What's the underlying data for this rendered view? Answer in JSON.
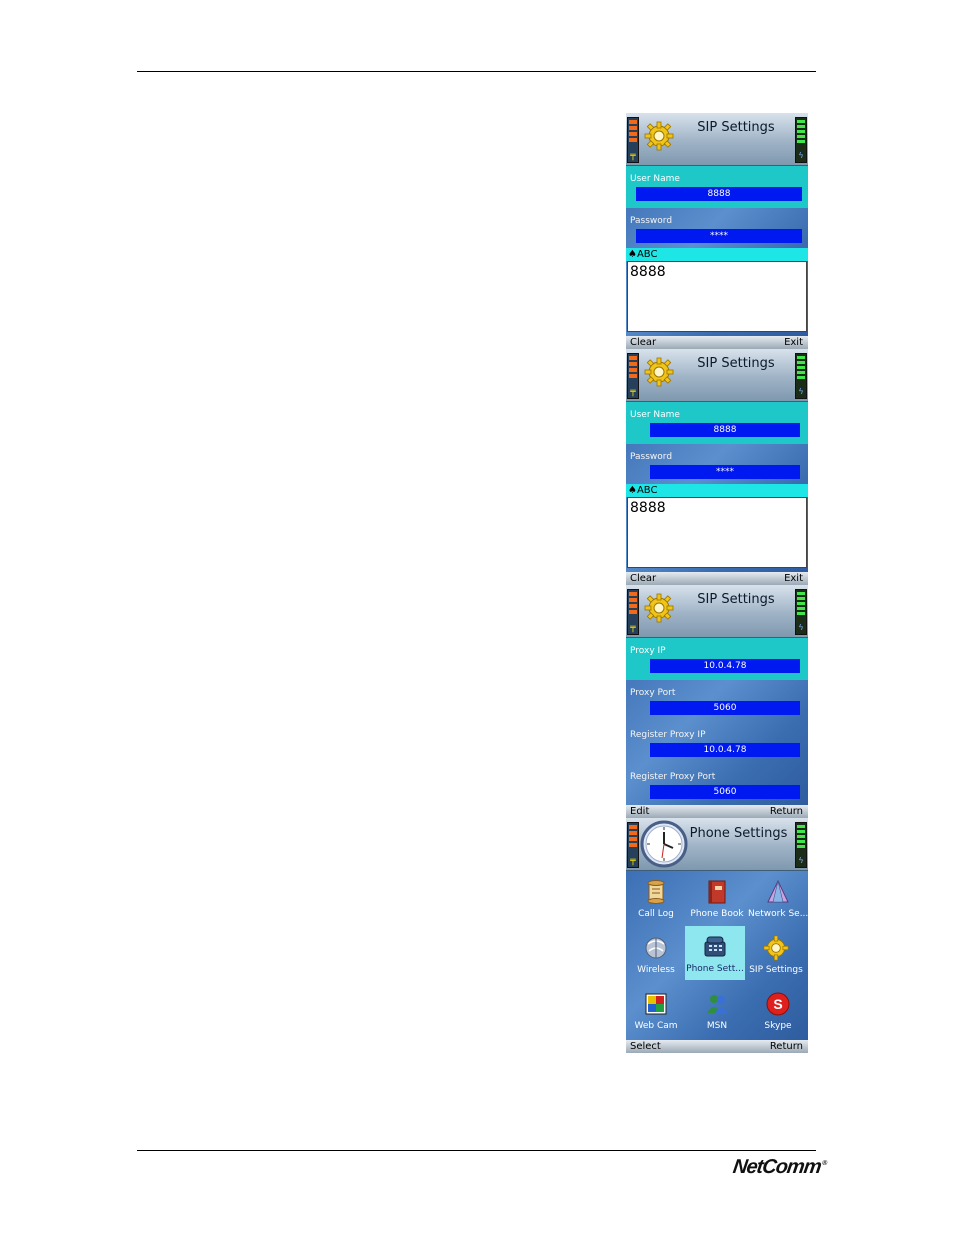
{
  "screens": [
    {
      "title": "SIP Settings",
      "fields": [
        {
          "label": "User Name",
          "value": "8888"
        },
        {
          "label": "Password",
          "value": "****"
        }
      ],
      "input_mode": "ABC",
      "input_text": "8888",
      "softkeys": {
        "left": "Clear",
        "right": "Exit"
      }
    },
    {
      "title": "SIP Settings",
      "fields": [
        {
          "label": "User Name",
          "value": "8888"
        },
        {
          "label": "Password",
          "value": "****"
        }
      ],
      "input_mode": "ABC",
      "input_text": "8888",
      "softkeys": {
        "left": "Clear",
        "right": "Exit"
      }
    },
    {
      "title": "SIP Settings",
      "fields": [
        {
          "label": "Proxy IP",
          "value": "10.0.4.78"
        },
        {
          "label": "Proxy Port",
          "value": "5060"
        },
        {
          "label": "Register Proxy IP",
          "value": "10.0.4.78"
        },
        {
          "label": "Register Proxy Port",
          "value": "5060"
        }
      ],
      "softkeys": {
        "left": "Edit",
        "right": "Return"
      }
    },
    {
      "title": "Phone Settings",
      "menu": [
        {
          "label": "Call Log",
          "icon": "call-log-icon"
        },
        {
          "label": "Phone Book",
          "icon": "phone-book-icon"
        },
        {
          "label": "Network Se...",
          "icon": "network-settings-icon"
        },
        {
          "label": "Wireless",
          "icon": "wireless-icon"
        },
        {
          "label": "Phone Sett...",
          "icon": "phone-settings-icon",
          "selected": true
        },
        {
          "label": "SIP Settings",
          "icon": "sip-settings-icon"
        },
        {
          "label": "Web Cam",
          "icon": "web-cam-icon"
        },
        {
          "label": "MSN",
          "icon": "msn-icon"
        },
        {
          "label": "Skype",
          "icon": "skype-icon"
        }
      ],
      "softkeys": {
        "left": "Select",
        "right": "Return"
      }
    }
  ],
  "colors": {
    "highlight": "#1ec8c8",
    "value_box": "#0019f0",
    "background": "#4a7fc2",
    "selected_tile": "#8ee6ef"
  },
  "footer_logo": "NetComm",
  "footer_logo_mark": "®"
}
